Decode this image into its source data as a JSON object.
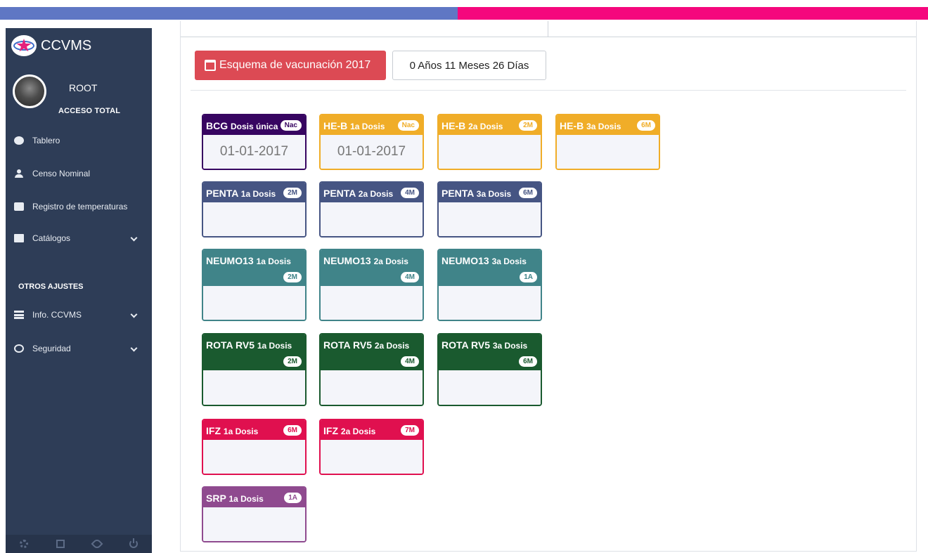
{
  "colors": {
    "topbar_left": "#5f77c4",
    "topbar_right": "#f5077d",
    "sidebar_bg": "#2e3d57",
    "schedule_button": "#dc4a54"
  },
  "brand": {
    "name": "CCVMS",
    "logo_text": "CCVMS"
  },
  "user": {
    "name": "ROOT",
    "role": "ACCESO TOTAL"
  },
  "nav": {
    "items": [
      {
        "label": "Tablero",
        "icon": "dashboard-icon"
      },
      {
        "label": "Censo Nominal",
        "icon": "users-icon"
      },
      {
        "label": "Registro de temperaturas",
        "icon": "share-icon"
      },
      {
        "label": "Catálogos",
        "icon": "archive-icon"
      }
    ],
    "section_title": "OTROS AJUSTES",
    "other_items": [
      {
        "label": "Info. CCVMS",
        "icon": "server-icon"
      },
      {
        "label": "Seguridad",
        "icon": "shield-icon"
      }
    ],
    "footer_icons": [
      "gear-icon",
      "expand-icon",
      "eye-slash-icon",
      "power-icon"
    ]
  },
  "main": {
    "schedule_label": "Esquema de vacunación 2017",
    "age": "0 Años 11 Meses 26 Días"
  },
  "vaccines": [
    {
      "name": "BCG",
      "dose": "Dosis única",
      "badge": "Nac",
      "date": "01-01-2017",
      "color": "#370561"
    },
    {
      "name": "HE-B",
      "dose": "1a Dosis",
      "badge": "Nac",
      "date": "01-01-2017",
      "color": "#f0ad28"
    },
    {
      "name": "HE-B",
      "dose": "2a Dosis",
      "badge": "2M",
      "date": "",
      "color": "#f0ad28"
    },
    {
      "name": "HE-B",
      "dose": "3a Dosis",
      "badge": "6M",
      "date": "",
      "color": "#f0ad28"
    },
    {
      "name": "PENTA",
      "dose": "1a Dosis",
      "badge": "2M",
      "date": "",
      "color": "#465583"
    },
    {
      "name": "PENTA",
      "dose": "2a Dosis",
      "badge": "4M",
      "date": "",
      "color": "#465583"
    },
    {
      "name": "PENTA",
      "dose": "3a Dosis",
      "badge": "6M",
      "date": "",
      "color": "#465583"
    },
    {
      "name": "NEUMO13",
      "dose": "1a Dosis",
      "badge": "2M",
      "date": "",
      "color": "#408489"
    },
    {
      "name": "NEUMO13",
      "dose": "2a Dosis",
      "badge": "4M",
      "date": "",
      "color": "#408489"
    },
    {
      "name": "NEUMO13",
      "dose": "3a Dosis",
      "badge": "1A",
      "date": "",
      "color": "#408489"
    },
    {
      "name": "ROTA RV5",
      "dose": "1a Dosis",
      "badge": "2M",
      "date": "",
      "color": "#1a5a2f"
    },
    {
      "name": "ROTA RV5",
      "dose": "2a Dosis",
      "badge": "4M",
      "date": "",
      "color": "#1a5a2f"
    },
    {
      "name": "ROTA RV5",
      "dose": "3a Dosis",
      "badge": "6M",
      "date": "",
      "color": "#1a5a2f"
    },
    {
      "name": "IFZ",
      "dose": "1a Dosis",
      "badge": "6M",
      "date": "",
      "color": "#e0104f"
    },
    {
      "name": "IFZ",
      "dose": "2a Dosis",
      "badge": "7M",
      "date": "",
      "color": "#e0104f"
    },
    {
      "name": "SRP",
      "dose": "1a Dosis",
      "badge": "1A",
      "date": "",
      "color": "#8f4a8f"
    }
  ]
}
